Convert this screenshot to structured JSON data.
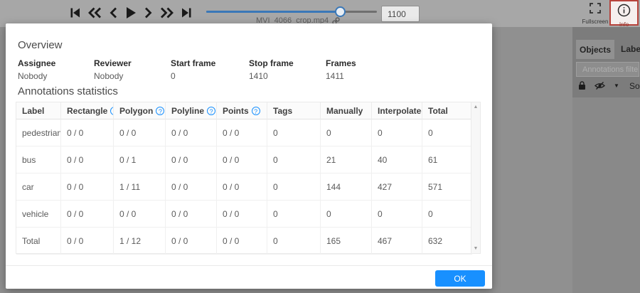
{
  "top_bar": {
    "player_icons": [
      "first-frame-icon",
      "backward-jump-icon",
      "previous-frame-icon",
      "play-icon",
      "next-frame-icon",
      "forward-jump-icon",
      "last-frame-icon"
    ],
    "filename": "MVI_4066_crop.mp4",
    "filename_link_icon": "link-icon",
    "frame_input_value": "1100",
    "slider_percent": 78,
    "fullscreen_icon": "fullscreen-icon",
    "fullscreen_label": "Fullscreen",
    "info_icon": "info-circle-icon",
    "info_label": "Info"
  },
  "sidebar": {
    "tabs": [
      {
        "label": "Objects",
        "active": true
      },
      {
        "label": "Labels",
        "active": false
      }
    ],
    "filter_icon": "filter-funnel-icon",
    "filter_placeholder": "Annotations filters",
    "toolbar_icons": [
      "lock-icon",
      "hide-eye-icon",
      "caret-down-icon"
    ],
    "sort_label_visible": "So"
  },
  "modal": {
    "overview_title": "Overview",
    "overview_fields": [
      {
        "label": "Assignee",
        "value": "Nobody"
      },
      {
        "label": "Reviewer",
        "value": "Nobody"
      },
      {
        "label": "Start frame",
        "value": "0"
      },
      {
        "label": "Stop frame",
        "value": "1410"
      },
      {
        "label": "Frames",
        "value": "1411"
      }
    ],
    "stats_title": "Annotations statistics",
    "table": {
      "columns": [
        {
          "label": "Label",
          "help": false
        },
        {
          "label": "Rectangle",
          "help": true
        },
        {
          "label": "Polygon",
          "help": true
        },
        {
          "label": "Polyline",
          "help": true
        },
        {
          "label": "Points",
          "help": true
        },
        {
          "label": "Tags",
          "help": false
        },
        {
          "label": "Manually",
          "help": false
        },
        {
          "label": "Interpolated",
          "help": false
        },
        {
          "label": "Total",
          "help": false
        }
      ],
      "rows": [
        {
          "label": "pedestrian",
          "cells": [
            "0 / 0",
            "0 / 0",
            "0 / 0",
            "0 / 0",
            "0",
            "0",
            "0",
            "0"
          ]
        },
        {
          "label": "bus",
          "cells": [
            "0 / 0",
            "0 / 1",
            "0 / 0",
            "0 / 0",
            "0",
            "21",
            "40",
            "61"
          ]
        },
        {
          "label": "car",
          "cells": [
            "0 / 0",
            "1 / 11",
            "0 / 0",
            "0 / 0",
            "0",
            "144",
            "427",
            "571"
          ]
        },
        {
          "label": "vehicle",
          "cells": [
            "0 / 0",
            "0 / 0",
            "0 / 0",
            "0 / 0",
            "0",
            "0",
            "0",
            "0"
          ]
        },
        {
          "label": "Total",
          "cells": [
            "0 / 0",
            "1 / 12",
            "0 / 0",
            "0 / 0",
            "0",
            "165",
            "467",
            "632"
          ]
        }
      ]
    },
    "ok_label": "OK"
  },
  "colors": {
    "accent_blue": "#1890ff",
    "slider_blue": "#3a78b8",
    "info_highlight_red": "#b7433c",
    "modal_bg": "#ffffff",
    "toolbar_bg": "#a7a7a7",
    "dimmed_bg": "#909090"
  }
}
